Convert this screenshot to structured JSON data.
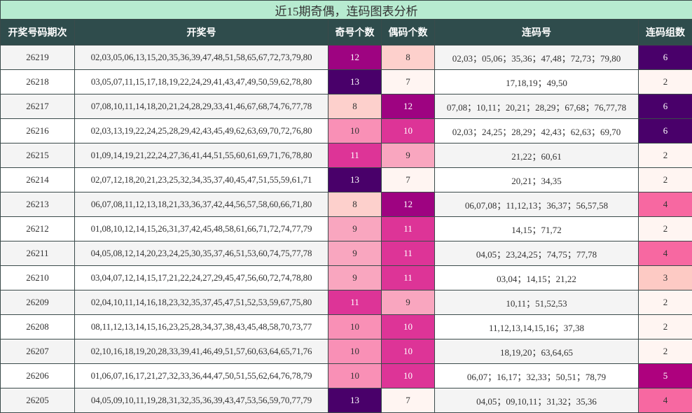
{
  "title": "近15期奇偶，连码图表分析",
  "headers": [
    "开奖号码期次",
    "开奖号",
    "奇号个数",
    "偶码个数",
    "连码号",
    "连码组数"
  ],
  "colors": {
    "title_bg": "#b7ebd0",
    "header_bg": "#2f4c4c",
    "header_text": "#ffffff",
    "border": "#3a4a4a",
    "scale": {
      "2": "#fff5f2",
      "3": "#fdcac4",
      "4": "#f768a1",
      "5": "#ae017e",
      "6": "#49006a",
      "7": "#fff5f2",
      "8": "#fdd0cc",
      "9": "#f9a6bf",
      "10": "#f990b6",
      "11": "#dd3497",
      "12": "#9e0381",
      "13": "#49006a"
    }
  },
  "rows": [
    {
      "period": "26219",
      "numbers": "02,03,05,06,13,15,20,35,36,39,47,48,51,58,65,67,72,73,79,80",
      "odd": "12",
      "even": "8",
      "chain": "02,03；05,06；35,36；47,48；72,73；79,80",
      "groups": "6"
    },
    {
      "period": "26218",
      "numbers": "03,05,07,11,15,17,18,19,22,24,29,41,43,47,49,50,59,62,78,80",
      "odd": "13",
      "even": "7",
      "chain": "17,18,19；49,50",
      "groups": "2"
    },
    {
      "period": "26217",
      "numbers": "07,08,10,11,14,18,20,21,24,28,29,33,41,46,67,68,74,76,77,78",
      "odd": "8",
      "even": "12",
      "chain": "07,08；10,11；20,21；28,29；67,68；76,77,78",
      "groups": "6"
    },
    {
      "period": "26216",
      "numbers": "02,03,13,19,22,24,25,28,29,42,43,45,49,62,63,69,70,72,76,80",
      "odd": "10",
      "even": "10",
      "chain": "02,03；24,25；28,29；42,43；62,63；69,70",
      "groups": "6"
    },
    {
      "period": "26215",
      "numbers": "01,09,14,19,21,22,24,27,36,41,44,51,55,60,61,69,71,76,78,80",
      "odd": "11",
      "even": "9",
      "chain": "21,22；60,61",
      "groups": "2"
    },
    {
      "period": "26214",
      "numbers": "02,07,12,18,20,21,23,25,32,34,35,37,40,45,47,51,55,59,61,71",
      "odd": "13",
      "even": "7",
      "chain": "20,21；34,35",
      "groups": "2"
    },
    {
      "period": "26213",
      "numbers": "06,07,08,11,12,13,18,21,33,36,37,42,44,56,57,58,60,66,71,80",
      "odd": "8",
      "even": "12",
      "chain": "06,07,08；11,12,13；36,37；56,57,58",
      "groups": "4"
    },
    {
      "period": "26212",
      "numbers": "01,08,10,12,14,15,26,31,37,42,45,48,58,61,66,71,72,74,77,79",
      "odd": "9",
      "even": "11",
      "chain": "14,15；71,72",
      "groups": "2"
    },
    {
      "period": "26211",
      "numbers": "04,05,08,12,14,20,23,24,25,30,35,37,46,51,53,60,74,75,77,78",
      "odd": "9",
      "even": "11",
      "chain": "04,05；23,24,25；74,75；77,78",
      "groups": "4"
    },
    {
      "period": "26210",
      "numbers": "03,04,07,12,14,15,17,21,22,24,27,29,45,47,56,60,72,74,78,80",
      "odd": "9",
      "even": "11",
      "chain": "03,04；14,15；21,22",
      "groups": "3"
    },
    {
      "period": "26209",
      "numbers": "02,04,10,11,14,16,18,23,32,35,37,45,47,51,52,53,59,67,75,80",
      "odd": "11",
      "even": "9",
      "chain": "10,11；51,52,53",
      "groups": "2"
    },
    {
      "period": "26208",
      "numbers": "08,11,12,13,14,15,16,23,25,28,34,37,38,43,45,48,58,70,73,77",
      "odd": "10",
      "even": "10",
      "chain": "11,12,13,14,15,16；37,38",
      "groups": "2"
    },
    {
      "period": "26207",
      "numbers": "02,10,16,18,19,20,28,33,39,41,46,49,51,57,60,63,64,65,71,76",
      "odd": "10",
      "even": "10",
      "chain": "18,19,20；63,64,65",
      "groups": "2"
    },
    {
      "period": "26206",
      "numbers": "01,06,07,16,17,21,27,32,33,36,44,47,50,51,55,62,64,76,78,79",
      "odd": "10",
      "even": "10",
      "chain": "06,07；16,17；32,33；50,51；78,79",
      "groups": "5"
    },
    {
      "period": "26205",
      "numbers": "04,05,09,10,11,19,28,31,32,35,36,39,43,47,53,56,59,70,77,79",
      "odd": "13",
      "even": "7",
      "chain": "04,05；09,10,11；31,32；35,36",
      "groups": "4"
    }
  ]
}
